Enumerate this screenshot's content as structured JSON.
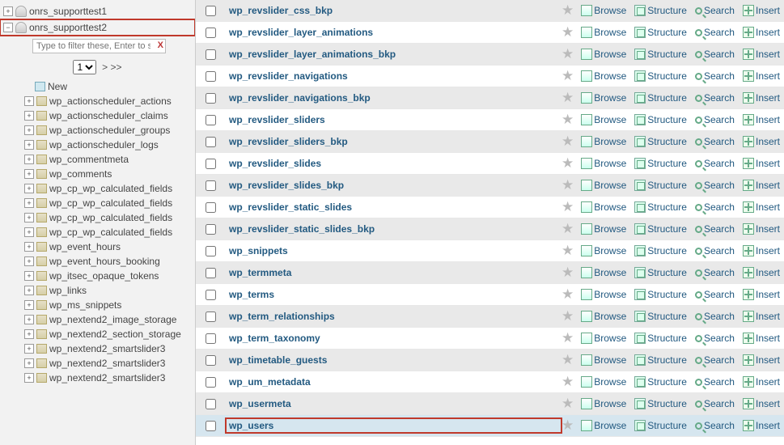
{
  "sidebar": {
    "db1": {
      "name": "onrs_supporttest1"
    },
    "db2": {
      "name": "onrs_supporttest2"
    },
    "filter_placeholder": "Type to filter these, Enter to search",
    "page_select": "1",
    "page_next": "> >>",
    "new_label": "New",
    "items": [
      {
        "label": "wp_actionscheduler_actions"
      },
      {
        "label": "wp_actionscheduler_claims"
      },
      {
        "label": "wp_actionscheduler_groups"
      },
      {
        "label": "wp_actionscheduler_logs"
      },
      {
        "label": "wp_commentmeta"
      },
      {
        "label": "wp_comments"
      },
      {
        "label": "wp_cp_wp_calculated_fields"
      },
      {
        "label": "wp_cp_wp_calculated_fields"
      },
      {
        "label": "wp_cp_wp_calculated_fields"
      },
      {
        "label": "wp_cp_wp_calculated_fields"
      },
      {
        "label": "wp_event_hours"
      },
      {
        "label": "wp_event_hours_booking"
      },
      {
        "label": "wp_itsec_opaque_tokens"
      },
      {
        "label": "wp_links"
      },
      {
        "label": "wp_ms_snippets"
      },
      {
        "label": "wp_nextend2_image_storage"
      },
      {
        "label": "wp_nextend2_section_storage"
      },
      {
        "label": "wp_nextend2_smartslider3"
      },
      {
        "label": "wp_nextend2_smartslider3"
      },
      {
        "label": "wp_nextend2_smartslider3"
      }
    ]
  },
  "actions": {
    "browse": "Browse",
    "structure": "Structure",
    "search": "Search",
    "insert": "Insert"
  },
  "tables": [
    {
      "name": "wp_revslider_css_bkp"
    },
    {
      "name": "wp_revslider_layer_animations"
    },
    {
      "name": "wp_revslider_layer_animations_bkp"
    },
    {
      "name": "wp_revslider_navigations"
    },
    {
      "name": "wp_revslider_navigations_bkp"
    },
    {
      "name": "wp_revslider_sliders"
    },
    {
      "name": "wp_revslider_sliders_bkp"
    },
    {
      "name": "wp_revslider_slides"
    },
    {
      "name": "wp_revslider_slides_bkp"
    },
    {
      "name": "wp_revslider_static_slides"
    },
    {
      "name": "wp_revslider_static_slides_bkp"
    },
    {
      "name": "wp_snippets"
    },
    {
      "name": "wp_termmeta"
    },
    {
      "name": "wp_terms"
    },
    {
      "name": "wp_term_relationships"
    },
    {
      "name": "wp_term_taxonomy"
    },
    {
      "name": "wp_timetable_guests"
    },
    {
      "name": "wp_um_metadata"
    },
    {
      "name": "wp_usermeta"
    },
    {
      "name": "wp_users",
      "highlight": true
    }
  ]
}
